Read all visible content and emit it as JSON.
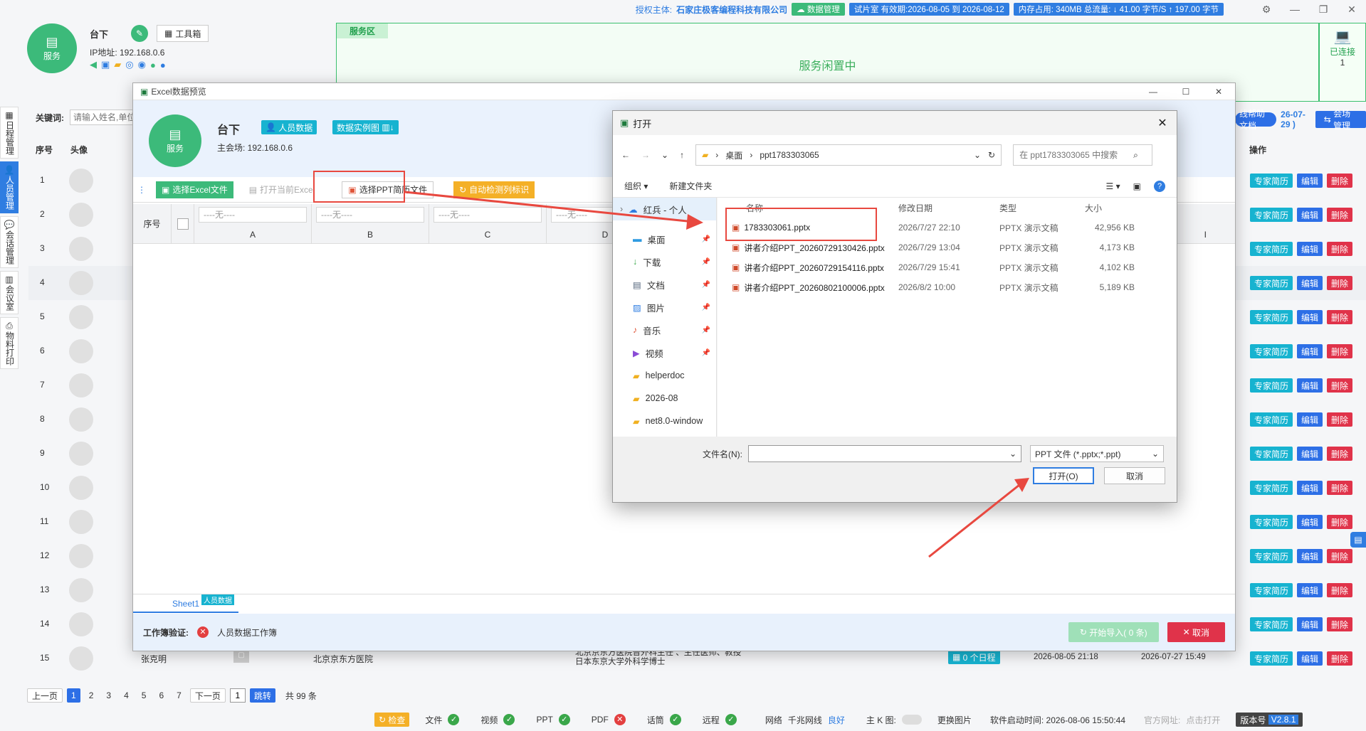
{
  "top": {
    "auth_label": "授权主体:",
    "auth_company": "石家庄极客编程科技有限公司",
    "data_mgmt": "数据管理",
    "trial": "试片室 有效期:2026-08-05 到 2026-08-12",
    "memory": "内存占用:   340MB   总流量:  ↓ 41.00 字节/S    ↑ 197.00 字节",
    "client_name": "台下",
    "toolbox": "工具箱",
    "ip": "IP地址: 192.168.0.6",
    "avatar_label": "服务",
    "service_area": "服务区",
    "service_idle": "服务闲置中",
    "connected_label": "已连接",
    "connected_count": "1"
  },
  "sidebar": [
    {
      "label": "日程管理"
    },
    {
      "label": "人员管理",
      "active": true
    },
    {
      "label": "会话管理"
    },
    {
      "label": "会议室"
    },
    {
      "label": "物料打印"
    }
  ],
  "list": {
    "keyword_label": "关键词:",
    "keyword_placeholder": "请输入姓名,单位",
    "help_doc": "线帮助文档",
    "date_suffix": "26-07-29 )",
    "venue_mgmt": "会场管理",
    "col_no": "序号",
    "col_avatar": "头像",
    "col_action": "操作",
    "btn_resume": "专家简历",
    "btn_edit": "编辑",
    "btn_delete": "删除",
    "rows": [
      "1",
      "2",
      "3",
      "4",
      "5",
      "6",
      "7",
      "8",
      "9",
      "10",
      "11",
      "12",
      "13",
      "14",
      "15"
    ],
    "row15_name": "张克明",
    "row15_hosp": "北京京东方医院",
    "row15_title1": "北京京东方医院普外科主任 、主任医师、教授",
    "row15_title2": "日本东京大学外科学博士",
    "row15_schedule": "0 个日程",
    "row15_t1": "2026-08-05 21:18",
    "row15_t2": "2026-07-27 15:49"
  },
  "pager": {
    "prev": "上一页",
    "pages": [
      "1",
      "2",
      "3",
      "4",
      "5",
      "6",
      "7"
    ],
    "next": "下一页",
    "jump_value": "1",
    "jump": "跳转",
    "total": "共 99 条"
  },
  "excel": {
    "title": "Excel数据预览",
    "name": "台下",
    "avatar_label": "服务",
    "person_data": "人员数据",
    "instance_chart": "数据实例图",
    "main_venue": "主会场: 192.168.0.6",
    "btn_select_excel": "选择Excel文件",
    "btn_open_excel": "打开当前Excel",
    "btn_select_ppt": "选择PPT简历文件",
    "btn_auto_detect": "自动检测列标识",
    "grid_no": "序号",
    "none_opt": "----无----",
    "cols": [
      "A",
      "B",
      "C",
      "D"
    ],
    "col_i": "I",
    "sheet": "Sheet1",
    "sheet_tag": "人员数据",
    "verify_label": "工作簿验证:",
    "verify_text": "人员数据工作簿",
    "btn_start": "开始导入( 0 条)",
    "btn_cancel": "取消"
  },
  "dialog": {
    "title": "打开",
    "crumb1": "桌面",
    "crumb2": "ppt1783303065",
    "search_placeholder": "在 ppt1783303065 中搜索",
    "organize": "组织",
    "new_folder": "新建文件夹",
    "nav": [
      {
        "label": "红兵 - 个人",
        "icon": "cloud-icon"
      },
      {
        "label": "桌面",
        "icon": "desktop-icon"
      },
      {
        "label": "下载",
        "icon": "download-icon"
      },
      {
        "label": "文档",
        "icon": "document-icon"
      },
      {
        "label": "图片",
        "icon": "picture-icon"
      },
      {
        "label": "音乐",
        "icon": "music-icon"
      },
      {
        "label": "视频",
        "icon": "video-icon"
      },
      {
        "label": "helperdoc",
        "icon": "folder-icon"
      },
      {
        "label": "2026-08",
        "icon": "folder-icon"
      },
      {
        "label": "net8.0-window",
        "icon": "folder-icon"
      }
    ],
    "hdr_name": "名称",
    "hdr_date": "修改日期",
    "hdr_type": "类型",
    "hdr_size": "大小",
    "files": [
      {
        "name": "1783303061.pptx",
        "date": "2026/7/27 22:10",
        "type": "PPTX 演示文稿",
        "size": "42,956 KB"
      },
      {
        "name": "讲者介绍PPT_20260729130426.pptx",
        "date": "2026/7/29 13:04",
        "type": "PPTX 演示文稿",
        "size": "4,173 KB"
      },
      {
        "name": "讲者介绍PPT_20260729154116.pptx",
        "date": "2026/7/29 15:41",
        "type": "PPTX 演示文稿",
        "size": "4,102 KB"
      },
      {
        "name": "讲者介绍PPT_20260802100006.pptx",
        "date": "2026/8/2 10:00",
        "type": "PPTX 演示文稿",
        "size": "5,189 KB"
      }
    ],
    "filename_label": "文件名(N):",
    "filename_value": "",
    "filter": "PPT 文件 (*.pptx;*.ppt)",
    "btn_open": "打开(O)",
    "btn_cancel": "取消"
  },
  "status": {
    "check": "检查",
    "file": "文件",
    "video": "视频",
    "ppt": "PPT",
    "pdf": "PDF",
    "talk": "话筒",
    "remote": "远程",
    "network": "网络",
    "gigabit": "千兆网线",
    "good": "良好",
    "main_k": "主 K 图:",
    "change_pic": "更换图片",
    "start_time": "软件启动时间: 2026-08-06 15:50:44",
    "official": "官方网址:",
    "click_open": "点击打开",
    "version_label": "版本号",
    "version": "V2.8.1"
  },
  "colors": {
    "accent_green": "#3cba7a",
    "accent_blue": "#2d6fe6",
    "danger": "#e0334a",
    "cyan": "#17b3d0",
    "annotation": "#e8483f"
  }
}
